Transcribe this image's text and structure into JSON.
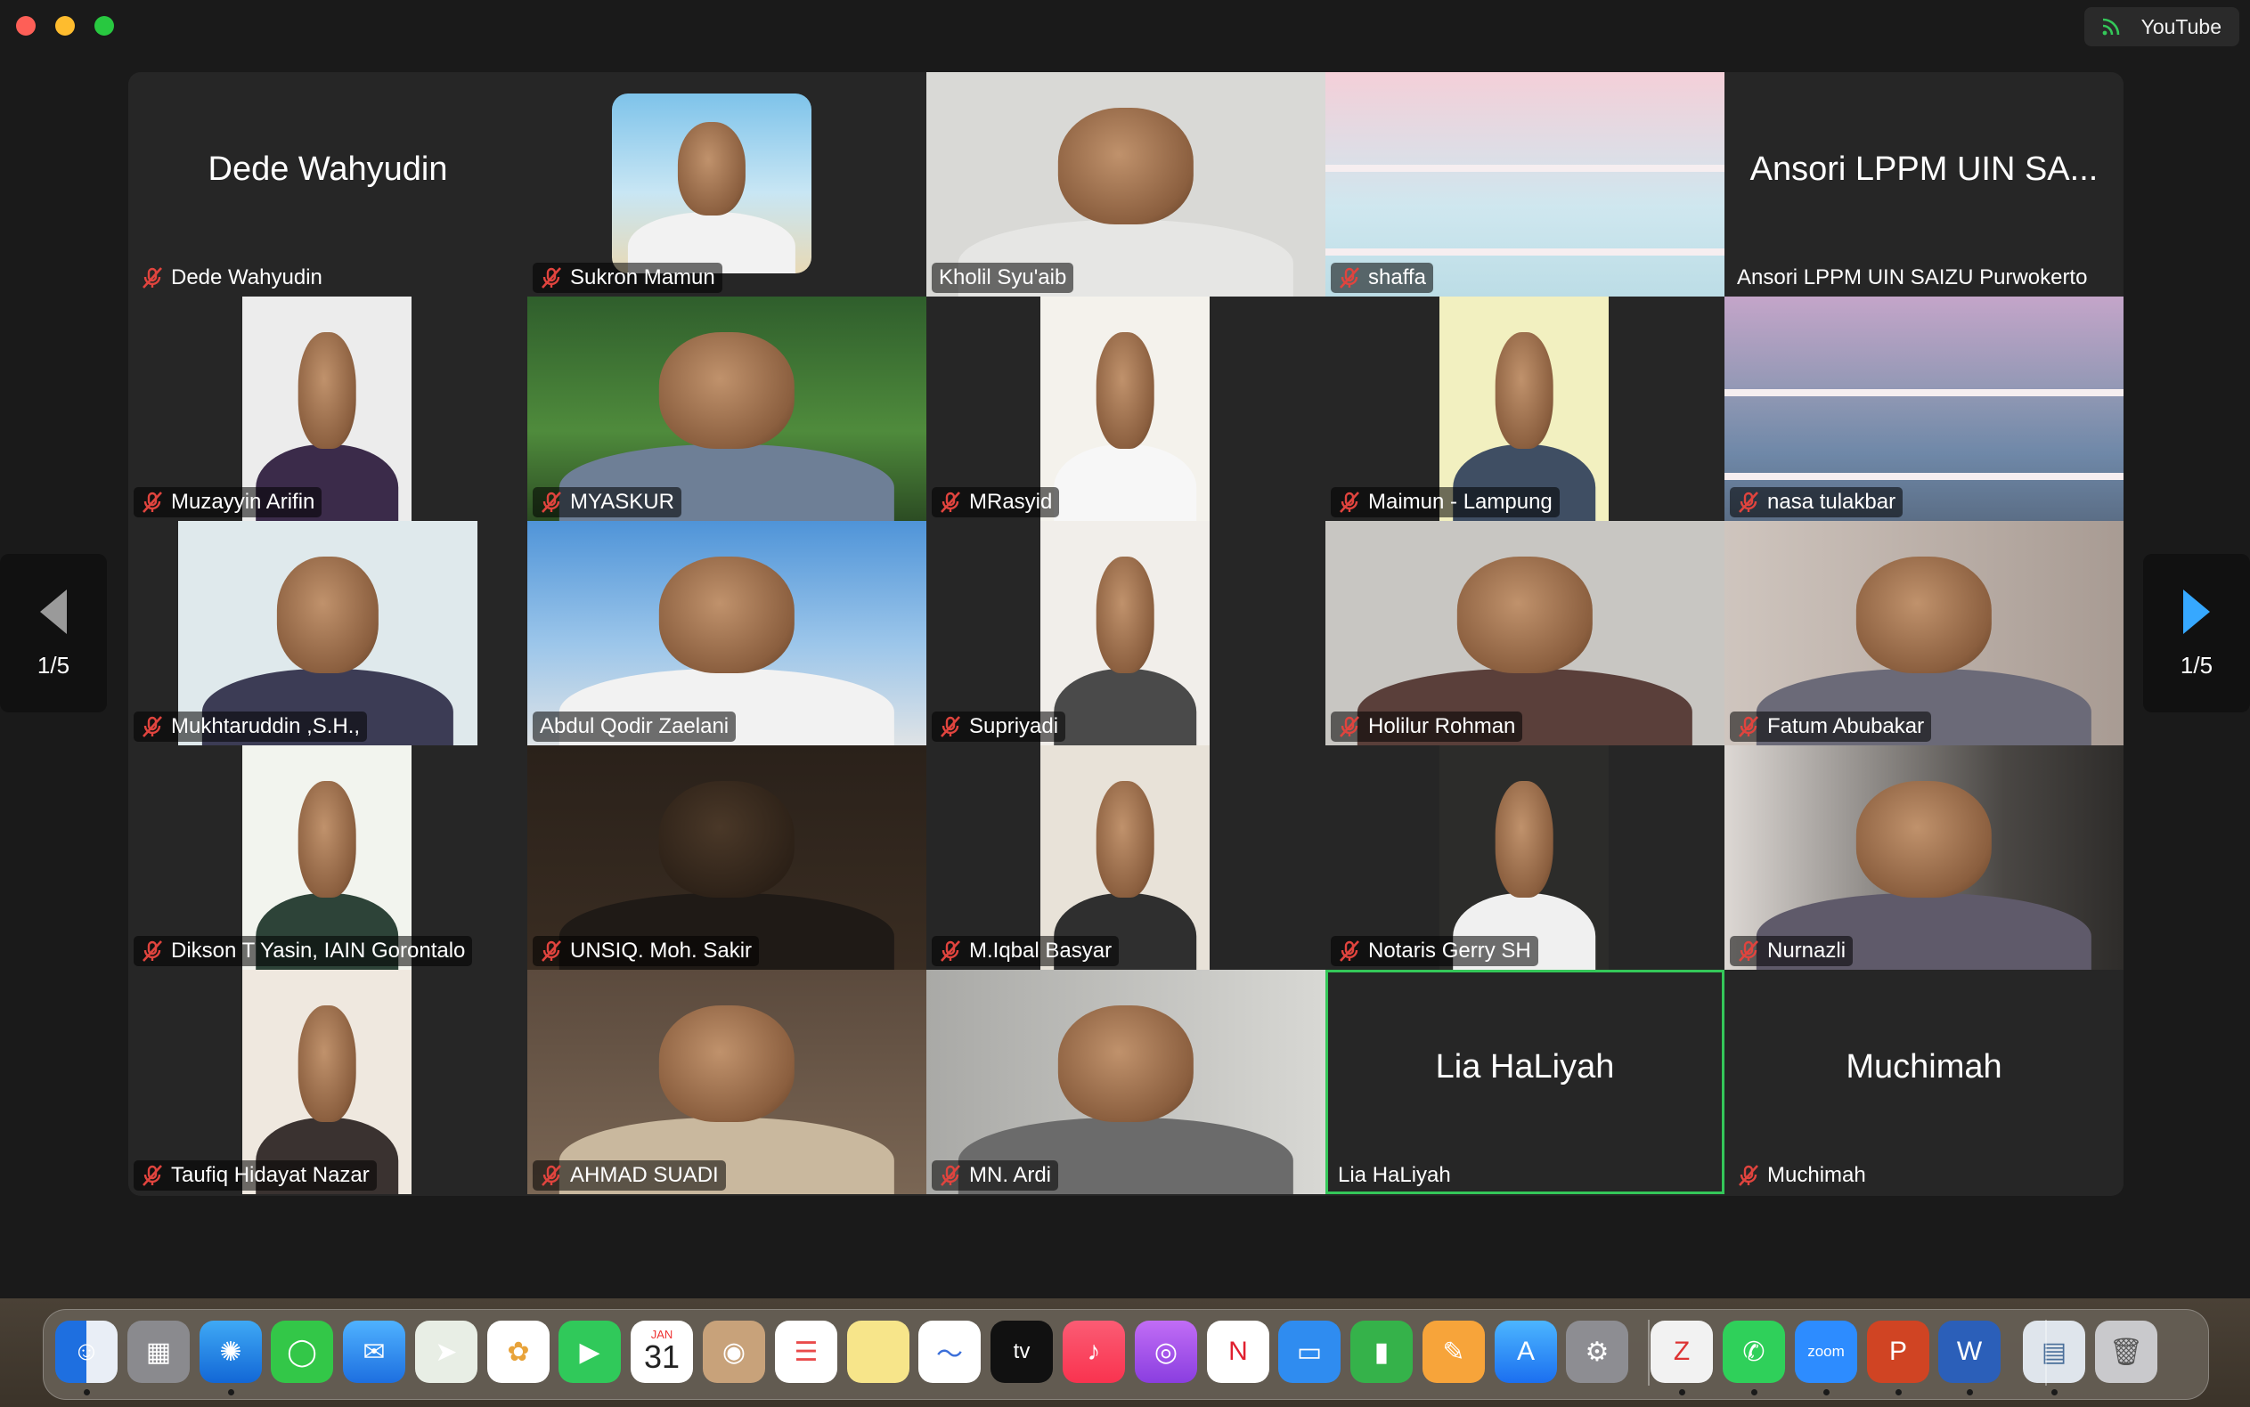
{
  "menubar": {
    "youtube_label": "YouTube"
  },
  "gallery": {
    "page_left": "1/5",
    "page_right": "1/5",
    "tiles": [
      {
        "name": "Dede Wahyudin",
        "center_name": "Dede Wahyudin",
        "muted": true,
        "kind": "name"
      },
      {
        "name": "Sukron Mamun",
        "muted": true,
        "kind": "video"
      },
      {
        "name": "Kholil Syu'aib",
        "muted": false,
        "kind": "video"
      },
      {
        "name": "shaffa",
        "muted": true,
        "kind": "image"
      },
      {
        "name": "Ansori LPPM UIN SAIZU Purwokerto",
        "center_name": "Ansori LPPM UIN SA...",
        "muted": false,
        "kind": "name"
      },
      {
        "name": "Muzayyin Arifin",
        "muted": true,
        "kind": "video"
      },
      {
        "name": "MYASKUR",
        "muted": true,
        "kind": "video"
      },
      {
        "name": "MRasyid",
        "muted": true,
        "kind": "video"
      },
      {
        "name": "Maimun - Lampung",
        "muted": true,
        "kind": "video"
      },
      {
        "name": "nasa tulakbar",
        "muted": true,
        "kind": "image"
      },
      {
        "name": "Mukhtaruddin ,S.H.,",
        "muted": true,
        "kind": "video"
      },
      {
        "name": "Abdul Qodir Zaelani",
        "muted": false,
        "kind": "video"
      },
      {
        "name": "Supriyadi",
        "muted": true,
        "kind": "video"
      },
      {
        "name": "Holilur Rohman",
        "muted": true,
        "kind": "video"
      },
      {
        "name": "Fatum Abubakar",
        "muted": true,
        "kind": "video"
      },
      {
        "name": "Dikson T Yasin, IAIN Gorontalo",
        "muted": true,
        "kind": "video"
      },
      {
        "name": "UNSIQ. Moh. Sakir",
        "muted": true,
        "kind": "video"
      },
      {
        "name": "M.Iqbal Basyar",
        "muted": true,
        "kind": "video"
      },
      {
        "name": "Notaris Gerry SH",
        "muted": true,
        "kind": "video"
      },
      {
        "name": "Nurnazli",
        "muted": true,
        "kind": "video"
      },
      {
        "name": "Taufiq Hidayat Nazar",
        "muted": true,
        "kind": "video"
      },
      {
        "name": "AHMAD SUADI",
        "muted": true,
        "kind": "video"
      },
      {
        "name": "MN. Ardi",
        "muted": true,
        "kind": "video"
      },
      {
        "name": "Lia HaLiyah",
        "center_name": "Lia HaLiyah",
        "muted": false,
        "kind": "name",
        "active": true
      },
      {
        "name": "Muchimah",
        "center_name": "Muchimah",
        "muted": true,
        "kind": "name"
      }
    ]
  },
  "dock": {
    "calendar_month": "JAN",
    "calendar_day": "31",
    "apple_tv_label": "tv",
    "zoom_label": "zoom",
    "items": [
      "Finder",
      "Launchpad",
      "Safari",
      "Messages",
      "Mail",
      "Maps",
      "Photos",
      "FaceTime",
      "Calendar",
      "Contacts",
      "Reminders",
      "Notes",
      "Freeform",
      "TV",
      "Music",
      "Podcasts",
      "News",
      "Keynote",
      "Numbers",
      "Pages",
      "App Store",
      "System Settings",
      "Zotero",
      "WhatsApp",
      "Zoom",
      "PowerPoint",
      "Word",
      "Preview",
      "Trash"
    ]
  }
}
